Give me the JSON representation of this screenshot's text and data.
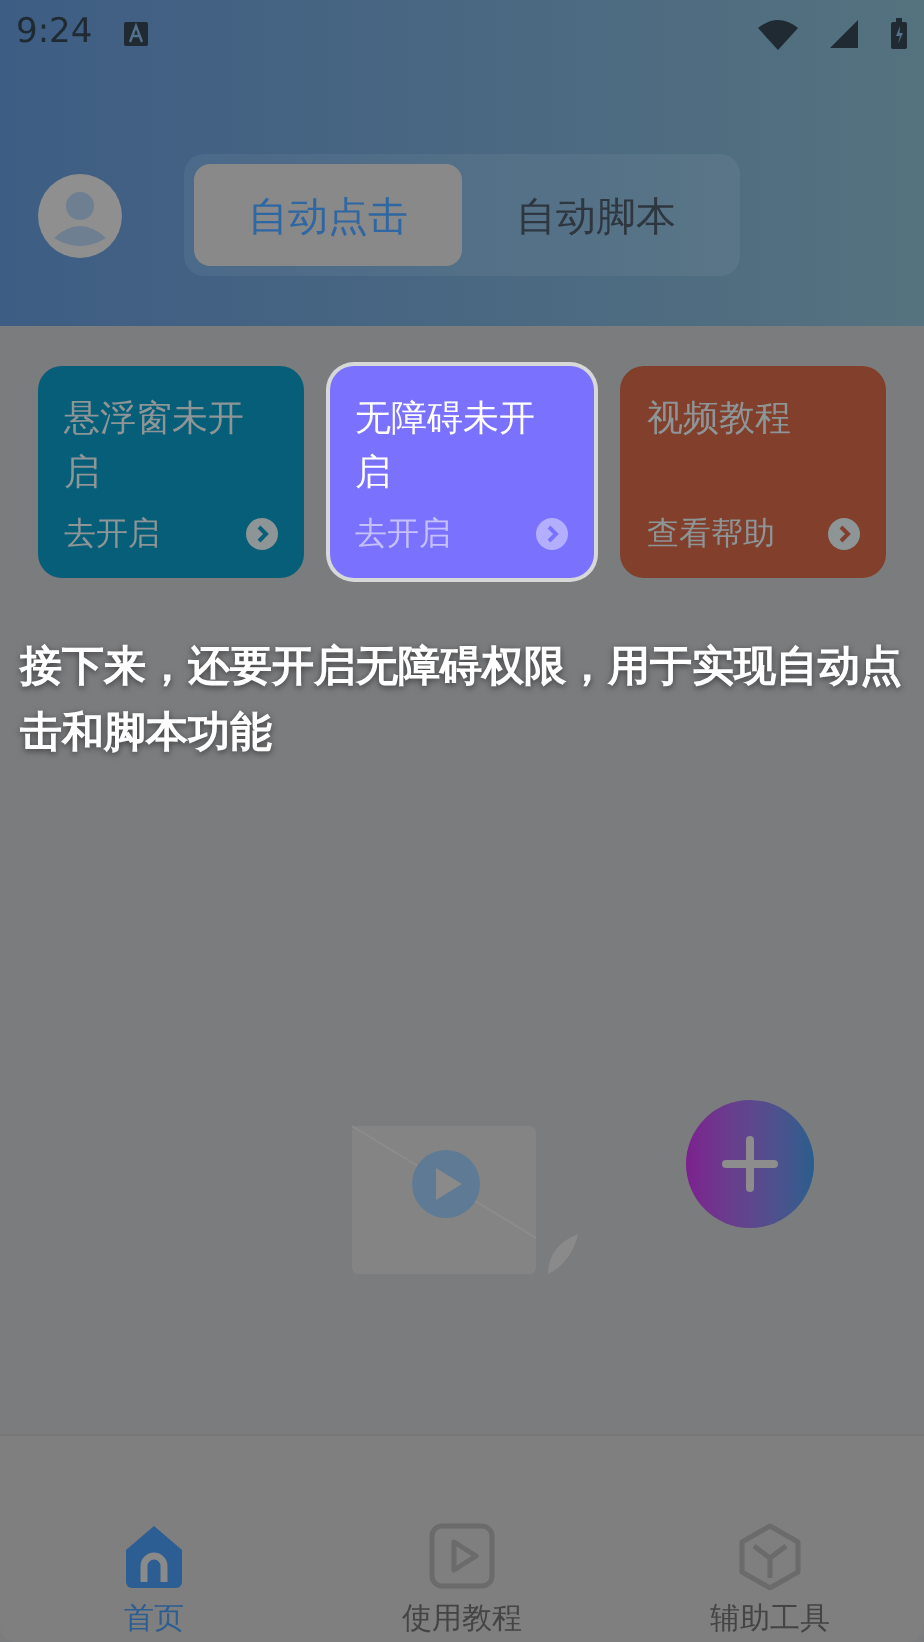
{
  "status_bar": {
    "time": "9:24"
  },
  "tabs": [
    {
      "label": "自动点击",
      "selected": true
    },
    {
      "label": "自动脚本",
      "selected": false
    }
  ],
  "cards": [
    {
      "title": "悬浮窗未开启",
      "action": "去开启",
      "highlighted": false,
      "color": "#075e78"
    },
    {
      "title": "无障碍未开启",
      "action": "去开启",
      "highlighted": true,
      "color": "#7a72ff"
    },
    {
      "title": "视频教程",
      "action": "查看帮助",
      "highlighted": false,
      "color": "#813f2c"
    }
  ],
  "guide_text": "接下来，还要开启无障碍权限，用于实现自动点击和脚本功能",
  "nav": [
    {
      "label": "首页",
      "selected": true,
      "kind": "home"
    },
    {
      "label": "使用教程",
      "selected": false,
      "kind": "play"
    },
    {
      "label": "辅助工具",
      "selected": false,
      "kind": "box"
    }
  ]
}
